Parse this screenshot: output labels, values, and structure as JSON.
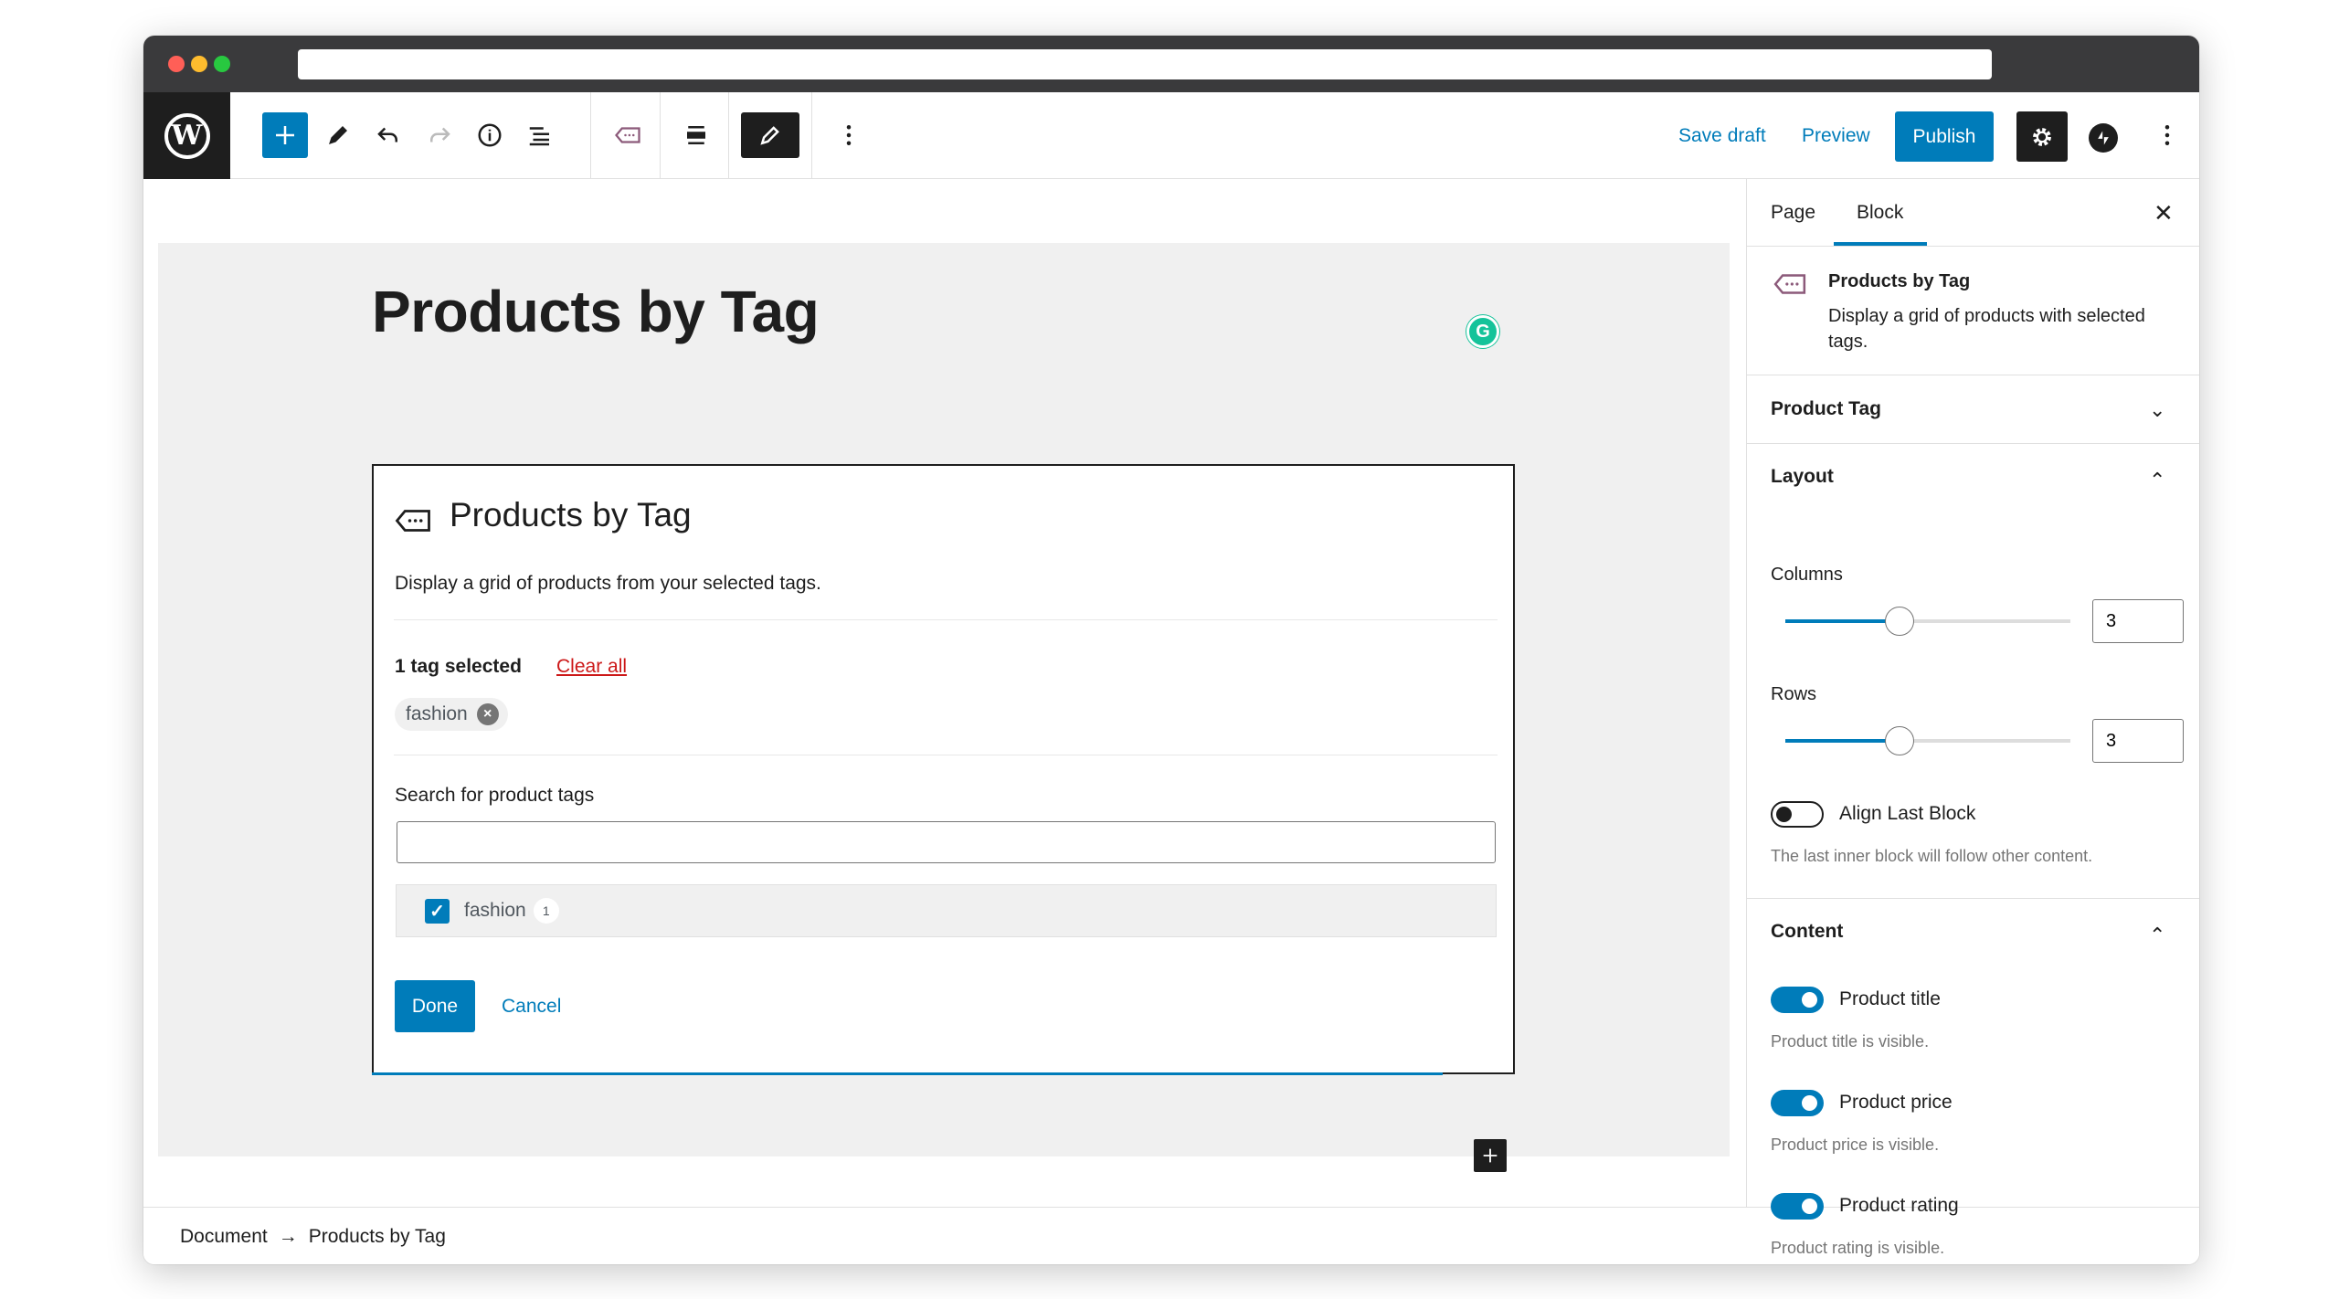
{
  "toolbar": {
    "save_draft": "Save draft",
    "preview": "Preview",
    "publish": "Publish"
  },
  "editor": {
    "page_title": "Products by Tag",
    "grammarly_badge": "G"
  },
  "block": {
    "title": "Products by Tag",
    "description": "Display a grid of products from your selected tags.",
    "selected_count": "1 tag selected",
    "clear_all": "Clear all",
    "selected_tags": [
      "fashion"
    ],
    "search_label": "Search for product tags",
    "search_value": "",
    "results": [
      {
        "label": "fashion",
        "count": "1",
        "checked": true
      }
    ],
    "done": "Done",
    "cancel": "Cancel"
  },
  "footer": {
    "breadcrumb": [
      "Document",
      "Products by Tag"
    ]
  },
  "sidebar": {
    "tabs": [
      "Page",
      "Block"
    ],
    "active_tab": "Block",
    "block_card": {
      "title": "Products by Tag",
      "description": "Display a grid of products with selected tags."
    },
    "product_tag_panel": "Product Tag",
    "layout": {
      "title": "Layout",
      "columns_label": "Columns",
      "columns_value": "3",
      "columns_fraction": 0.4,
      "rows_label": "Rows",
      "rows_value": "3",
      "rows_fraction": 0.4,
      "align_last_label": "Align Last Block",
      "align_last_on": false,
      "align_last_help": "The last inner block will follow other content."
    },
    "content": {
      "title": "Content",
      "items": [
        {
          "label": "Product title",
          "help": "Product title is visible.",
          "on": true
        },
        {
          "label": "Product price",
          "help": "Product price is visible.",
          "on": true
        },
        {
          "label": "Product rating",
          "help": "Product rating is visible.",
          "on": true
        }
      ]
    }
  },
  "colors": {
    "accent": "#007cba",
    "dark": "#1e1e1e",
    "danger": "#cc1818",
    "grammarly": "#15c39a"
  }
}
